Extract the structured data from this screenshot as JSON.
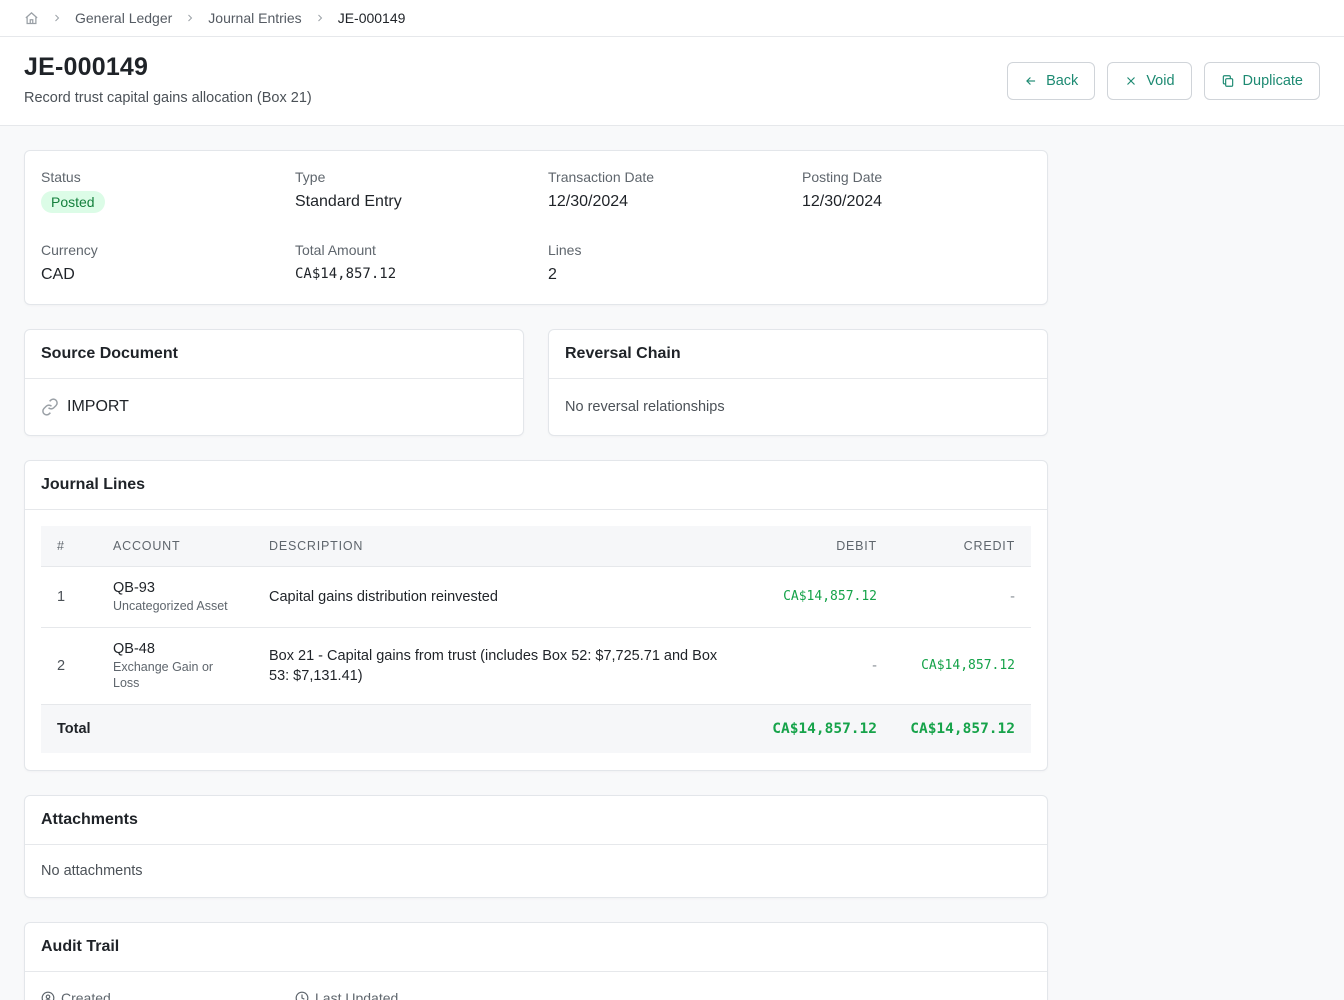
{
  "breadcrumb": {
    "items": [
      "General Ledger",
      "Journal Entries"
    ],
    "current": "JE-000149",
    "home_icon": "home-icon"
  },
  "header": {
    "title": "JE-000149",
    "subtitle": "Record trust capital gains allocation (Box 21)",
    "actions": {
      "back": "Back",
      "void": "Void",
      "duplicate": "Duplicate"
    }
  },
  "summary": {
    "status_label": "Status",
    "status_value": "Posted",
    "type_label": "Type",
    "type_value": "Standard Entry",
    "txn_date_label": "Transaction Date",
    "txn_date_value": "12/30/2024",
    "posting_date_label": "Posting Date",
    "posting_date_value": "12/30/2024",
    "currency_label": "Currency",
    "currency_value": "CAD",
    "total_label": "Total Amount",
    "total_value": "CA$14,857.12",
    "lines_label": "Lines",
    "lines_value": "2"
  },
  "source_document": {
    "title": "Source Document",
    "value": "IMPORT"
  },
  "reversal_chain": {
    "title": "Reversal Chain",
    "value": "No reversal relationships"
  },
  "journal_lines": {
    "title": "Journal Lines",
    "columns": [
      "#",
      "ACCOUNT",
      "DESCRIPTION",
      "DEBIT",
      "CREDIT"
    ],
    "rows": [
      {
        "num": "1",
        "account_code": "QB-93",
        "account_name": "Uncategorized Asset",
        "description": "Capital gains distribution reinvested",
        "debit": "CA$14,857.12",
        "credit": "-"
      },
      {
        "num": "2",
        "account_code": "QB-48",
        "account_name": "Exchange Gain or Loss",
        "description": "Box 21 - Capital gains from trust (includes Box 52: $7,725.71 and Box 53: $7,131.41)",
        "debit": "-",
        "credit": "CA$14,857.12"
      }
    ],
    "total": {
      "label": "Total",
      "debit": "CA$14,857.12",
      "credit": "CA$14,857.12"
    }
  },
  "attachments": {
    "title": "Attachments",
    "value": "No attachments"
  },
  "audit_trail": {
    "title": "Audit Trail",
    "created_label": "Created",
    "updated_label": "Last Updated"
  },
  "colors": {
    "accent": "#1d8a72",
    "amount_green": "#16a34a",
    "badge_bg": "#dcfce7",
    "badge_text": "#15803d"
  }
}
